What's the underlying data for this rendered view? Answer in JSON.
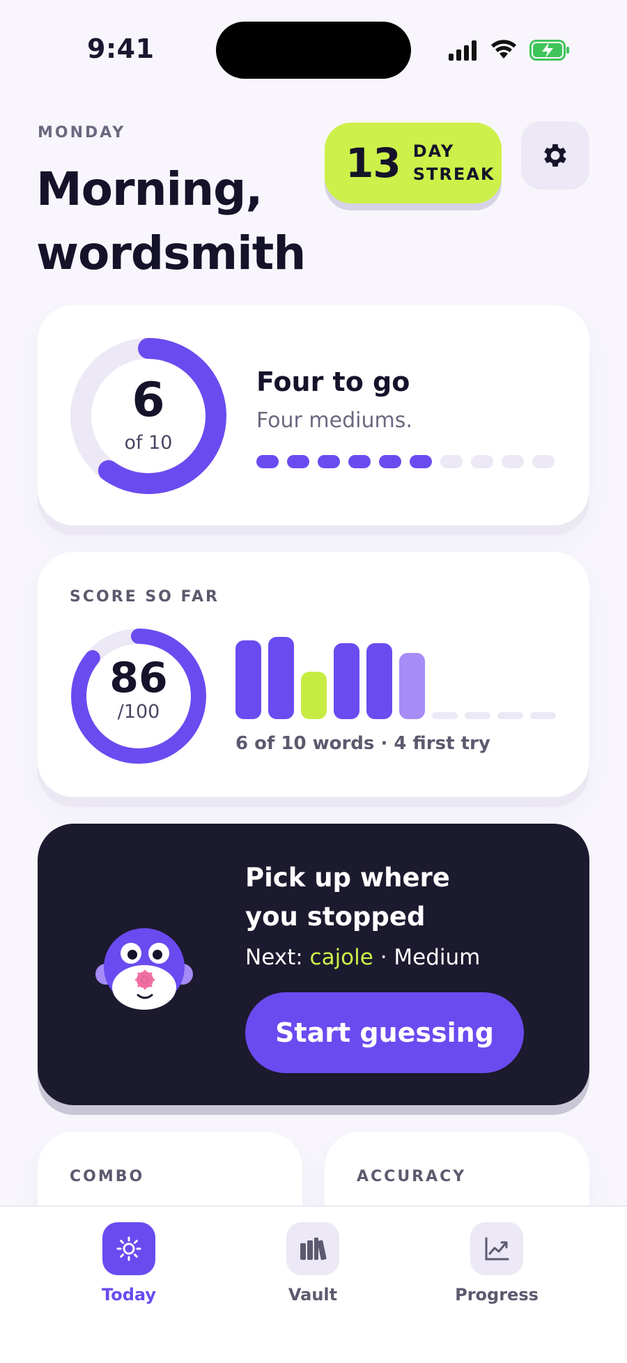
{
  "status_bar": {
    "time": "9:41"
  },
  "header": {
    "day": "MONDAY",
    "greeting_line1": "Morning,",
    "greeting_line2": "wordsmith",
    "streak": {
      "count": "13",
      "label_line1": "DAY",
      "label_line2": "STREAK"
    }
  },
  "progress_card": {
    "done": 6,
    "total": 10,
    "big_number": "6",
    "of_label": "of 10",
    "title": "Four to go",
    "subtitle": "Four mediums."
  },
  "score_card": {
    "label": "SCORE SO FAR",
    "score": 86,
    "score_text": "86",
    "out_of": "/100",
    "summary": "6 of 10 words · 4 first try",
    "word_bars": [
      {
        "level": 1.0,
        "color": "#6a4bf0"
      },
      {
        "level": 1.04,
        "color": "#6a4bf0"
      },
      {
        "level": 0.6,
        "color": "#c6ec42"
      },
      {
        "level": 0.96,
        "color": "#6a4bf0"
      },
      {
        "level": 0.96,
        "color": "#6a4bf0"
      },
      {
        "level": 0.84,
        "color": "#a58cf6"
      },
      {
        "level": 0,
        "color": "#ece8f5"
      },
      {
        "level": 0,
        "color": "#ece8f5"
      },
      {
        "level": 0,
        "color": "#ece8f5"
      },
      {
        "level": 0,
        "color": "#ece8f5"
      }
    ]
  },
  "resume_card": {
    "title_line1": "Pick up where",
    "title_line2": "you stopped",
    "next_prefix": "Next:",
    "next_word": "cajole",
    "next_sep": "·",
    "next_level": "Medium",
    "button": "Start guessing"
  },
  "mini_cards": {
    "combo_label": "COMBO",
    "accuracy_label": "ACCURACY"
  },
  "tabs": [
    {
      "label": "Today",
      "icon": "sun-icon",
      "active": true
    },
    {
      "label": "Vault",
      "icon": "books-icon",
      "active": false
    },
    {
      "label": "Progress",
      "icon": "chart-icon",
      "active": false
    }
  ],
  "colors": {
    "accent": "#6a4bf0",
    "lime": "#cdf04a",
    "dark_card": "#1c1a2e",
    "ring_track": "#ece8f5"
  }
}
